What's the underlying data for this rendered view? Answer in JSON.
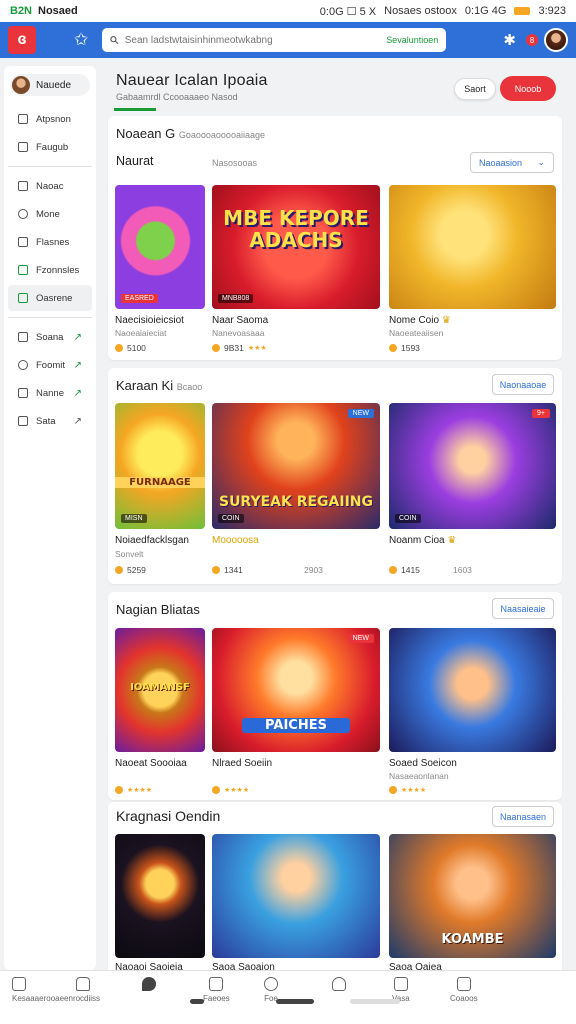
{
  "status_bar": {
    "carrier": "B2N",
    "left_text": "Nosaed",
    "center": "0:0G  ☐  5 X",
    "network": "Nosaes ostoox",
    "right_icons": "0:1G 4G",
    "time": "3:923"
  },
  "topbar": {
    "logo_text": "ɞ",
    "search_placeholder": "Sean ladstwtaisinhinmeotwkabng",
    "search_highlight": "Sevaluntioen",
    "notification_count": "8"
  },
  "sidebar": {
    "user": "Nauede",
    "group1": [
      {
        "label": "Atpsnon"
      },
      {
        "label": "Faugub"
      }
    ],
    "group2": [
      {
        "label": "Naoac"
      },
      {
        "label": "Mone"
      },
      {
        "label": "Flasnes"
      },
      {
        "label": "Fzonnsles"
      },
      {
        "label": "Oasrene"
      }
    ],
    "group3": [
      {
        "label": "Soana",
        "arrow": "↗"
      },
      {
        "label": "Foomit",
        "arrow": "↗"
      },
      {
        "label": "Nanne",
        "arrow": "↗"
      },
      {
        "label": "Sata",
        "arrow": "↗"
      }
    ]
  },
  "header": {
    "title": "Nauear Icalan Ipoaia",
    "subtitle": "Gabaamrdl  Ccooaaaeo  Nasod",
    "sort_label": "Saort",
    "action_label": "Nooob"
  },
  "sections": [
    {
      "title": "Noaean G",
      "title_note": "Goaoooaooooaiiaage",
      "subtitle": "Naurat",
      "subtitle_note": "Nasosooas",
      "select": "Naoaasion",
      "cards": [
        {
          "name": "Naecisioieicsiot",
          "meta": "Naoeaiaieciat",
          "rating": "5100",
          "stars": "",
          "overlay": "EASRED",
          "tag": "",
          "art": "KNAFX",
          "big": ""
        },
        {
          "name": "Naar Saoma",
          "meta": "Nanevoasaaa",
          "rating": "9B31",
          "stars": "★★★",
          "overlay": "MNB808",
          "tag": "",
          "art": "KEPORE ADACHS",
          "big": "MBE KEPORE ADACHS"
        },
        {
          "name": "Nome Coio",
          "meta": "Naoeateaiisen",
          "rating": "1593",
          "stars": "",
          "overlay": "",
          "tag": "",
          "art": "",
          "big": ""
        }
      ]
    },
    {
      "title": "Karaan Ki",
      "title_note": "Bcaoo",
      "select": "Naonaaoae",
      "cards": [
        {
          "name": "Noiaedfacklsgan",
          "meta": "Sonvelt",
          "rating": "5259",
          "stars": "",
          "overlay": "MISN",
          "tag": "",
          "art": "",
          "big": "FURNAAGE"
        },
        {
          "name": "Mooooosa",
          "meta": "",
          "rating": "1341",
          "stars": "",
          "rating_right": "2903",
          "overlay": "COIN",
          "tag": "NEW",
          "art": "",
          "big": "SURYEAK REGAIING"
        },
        {
          "name": "Noanm Cioa",
          "meta": "",
          "rating": "1415",
          "stars": "",
          "rating_right": "1603",
          "overlay": "COIN",
          "tag": "9+",
          "art": "",
          "big": ""
        }
      ]
    },
    {
      "title": "Nagian Bliatas",
      "title_note": "",
      "select": "Naasaieaie",
      "cards": [
        {
          "name": "Naoeat Soooiaa",
          "meta": "",
          "rating": "",
          "stars": "★★★★",
          "overlay": "",
          "tag": "",
          "art": "",
          "big": "IOAMANSF"
        },
        {
          "name": "Nlraed Soeiin",
          "meta": "",
          "rating": "",
          "stars": "★★★★",
          "overlay": "",
          "tag": "NEW",
          "art": "",
          "big": "PAICHES"
        },
        {
          "name": "Soaed Soeicon",
          "meta": "Nasaeaonlanan",
          "rating": "",
          "stars": "★★★★",
          "overlay": "",
          "tag": "",
          "art": "",
          "big": ""
        }
      ]
    },
    {
      "title": "Kragnasi Oendin",
      "title_note": "",
      "select": "Naanasaen",
      "cards": [
        {
          "name": "Naoaoi Saoieia",
          "meta": "",
          "rating": "",
          "stars": "",
          "overlay": "",
          "tag": "",
          "art": "",
          "big": ""
        },
        {
          "name": "Saoa Saoaion",
          "meta": "",
          "rating": "",
          "stars": "",
          "overlay": "",
          "tag": "",
          "art": "",
          "big": ""
        },
        {
          "name": "Saoa Oaiea",
          "meta": "",
          "rating": "",
          "stars": "",
          "overlay": "",
          "tag": "",
          "art": "",
          "big": "KOAMBE"
        }
      ]
    }
  ],
  "bottom_nav": [
    {
      "label": "Kesaaaerooaeenrocdiiss"
    },
    {
      "label": ""
    },
    {
      "label": "Faeoes"
    },
    {
      "label": "Foe"
    },
    {
      "label": ""
    },
    {
      "label": "Vasa"
    },
    {
      "label": "Coaoos"
    }
  ],
  "colors": {
    "brand_blue": "#2f6fd8",
    "brand_red": "#e9343b",
    "accent_green": "#1a9b3a",
    "star_gold": "#f5a623"
  }
}
